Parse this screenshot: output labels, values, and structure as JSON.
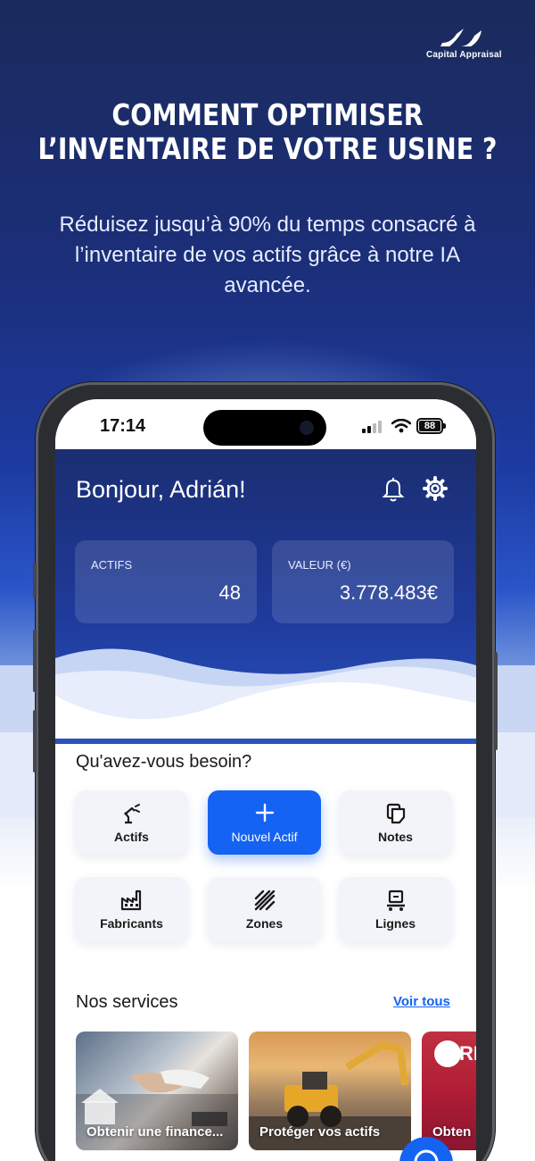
{
  "brand": {
    "name": "Capital Appraisal",
    "logo_icon": "capital-appraisal-logo"
  },
  "hero": {
    "title_line1": "COMMENT OPTIMISER",
    "title_line2": "L’INVENTAIRE DE VOTRE USINE ?",
    "subtitle": "Réduisez jusqu’à 90% du temps consacré à l’inventaire de vos actifs grâce à notre IA avancée."
  },
  "status_bar": {
    "time": "17:14",
    "battery": "88",
    "icons": [
      "signal-icon",
      "wifi-icon",
      "battery-icon"
    ]
  },
  "app": {
    "greeting": "Bonjour, Adrián!",
    "header_icons": [
      "bell-icon",
      "gear-icon"
    ],
    "stats": [
      {
        "label": "ACTIFS",
        "value": "48"
      },
      {
        "label": "VALEUR (€)",
        "value": "3.778.483€"
      }
    ],
    "needs_title": "Qu'avez-vous besoin?",
    "actions": [
      {
        "label": "Actifs",
        "icon": "robot-arm-icon"
      },
      {
        "label": "Nouvel Actif",
        "icon": "plus-icon"
      },
      {
        "label": "Notes",
        "icon": "notes-icon"
      },
      {
        "label": "Fabricants",
        "icon": "factory-icon"
      },
      {
        "label": "Zones",
        "icon": "striped-zone-icon"
      },
      {
        "label": "Lignes",
        "icon": "production-line-icon"
      }
    ],
    "services_title": "Nos services",
    "see_all": "Voir tous",
    "services": [
      {
        "label": "Obtenir une finance..."
      },
      {
        "label": "Protéger vos actifs"
      },
      {
        "label": "Obten",
        "logo_text": "RI"
      }
    ]
  },
  "colors": {
    "primary": "#1463f3",
    "header_dark": "#1b2e72",
    "tile_bg": "#f2f4f9"
  }
}
